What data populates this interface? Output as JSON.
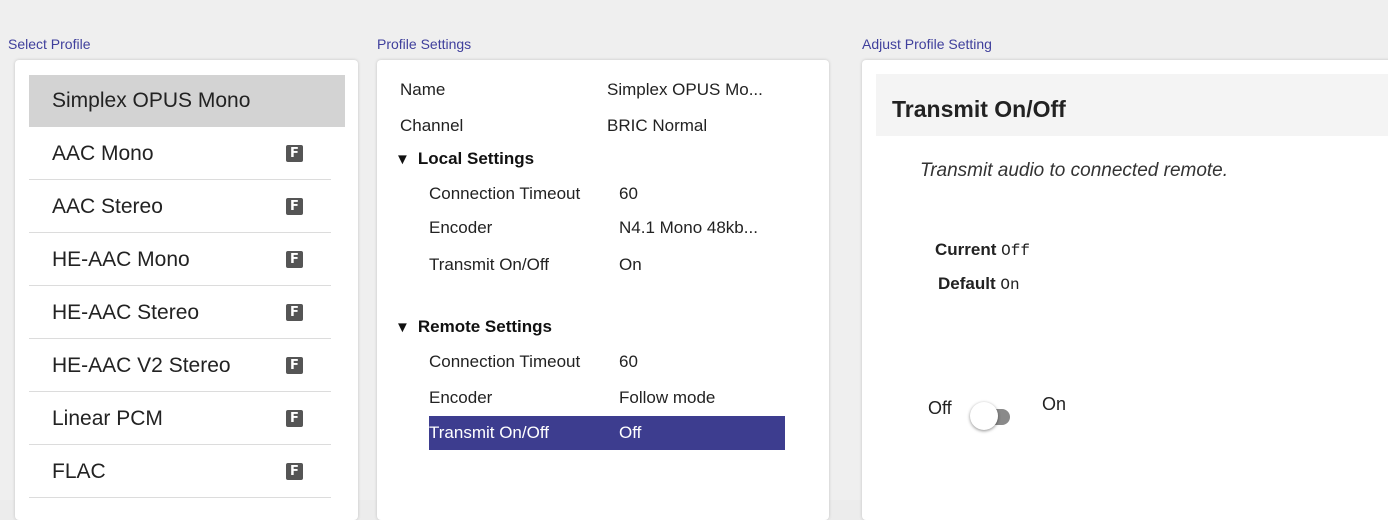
{
  "sections": {
    "select_profile": "Select Profile",
    "profile_settings": "Profile Settings",
    "adjust_profile_setting": "Adjust Profile Setting"
  },
  "profiles": [
    {
      "label": "Simplex OPUS Mono",
      "badge": ""
    },
    {
      "label": "AAC Mono",
      "badge": "F"
    },
    {
      "label": "AAC Stereo",
      "badge": "F"
    },
    {
      "label": "HE-AAC Mono",
      "badge": "F"
    },
    {
      "label": "HE-AAC Stereo",
      "badge": "F"
    },
    {
      "label": "HE-AAC V2 Stereo",
      "badge": "F"
    },
    {
      "label": "Linear PCM",
      "badge": "F"
    },
    {
      "label": "FLAC",
      "badge": "F"
    }
  ],
  "selected_profile": "Simplex OPUS Mono",
  "settings": {
    "name_label": "Name",
    "name_value": "Simplex OPUS Mo...",
    "channel_label": "Channel",
    "channel_value": "BRIC Normal",
    "local": {
      "heading": "Local Settings",
      "triangle": "▼",
      "timeout_label": "Connection Timeout",
      "timeout_value": "60",
      "encoder_label": "Encoder",
      "encoder_value": "N4.1 Mono 48kb...",
      "transmit_label": "Transmit On/Off",
      "transmit_value": "On"
    },
    "remote": {
      "heading": "Remote Settings",
      "triangle": "▼",
      "timeout_label": "Connection Timeout",
      "timeout_value": "60",
      "encoder_label": "Encoder",
      "encoder_value": "Follow mode",
      "transmit_label": "Transmit On/Off",
      "transmit_value": "Off"
    }
  },
  "adjust": {
    "title": "Transmit On/Off",
    "description": "Transmit audio to connected remote.",
    "current_label": "Current",
    "current_value": "Off",
    "default_label": "Default",
    "default_value": "On",
    "toggle_off_label": "Off",
    "toggle_on_label": "On",
    "toggle_state": "off"
  },
  "colors": {
    "section_title": "#3f3f9c",
    "highlight": "#3d3d8f",
    "selected_profile_bg": "#d3d3d3"
  }
}
